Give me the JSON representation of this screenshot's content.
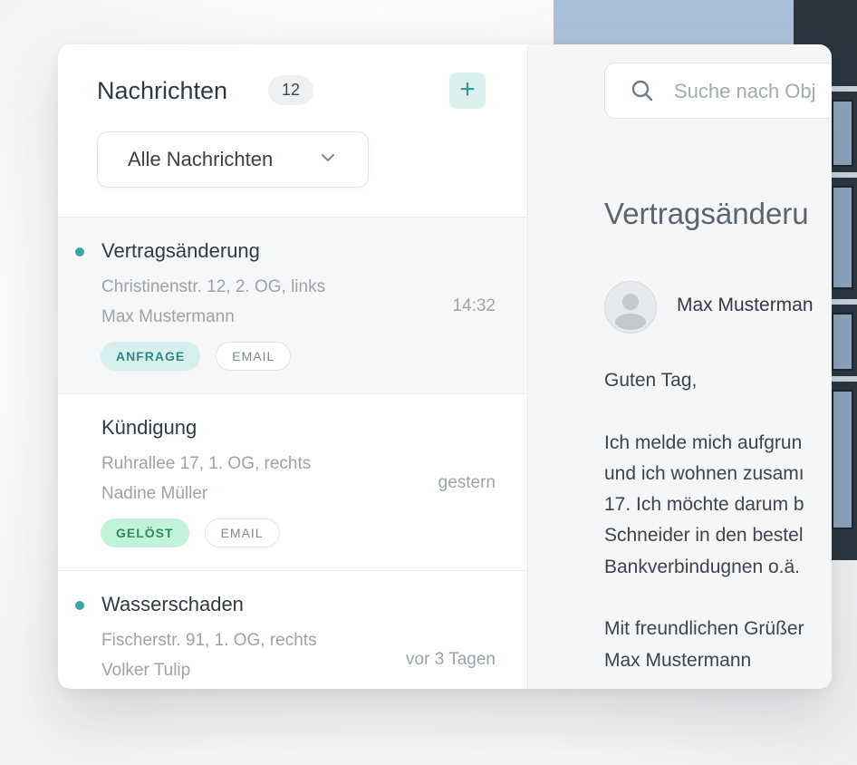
{
  "header": {
    "title": "Nachrichten",
    "count": "12",
    "add_label": "+"
  },
  "filter": {
    "selected": "Alle Nachrichten"
  },
  "messages": [
    {
      "title": "Vertragsänderung",
      "address": "Christinenstr. 12, 2. OG, links",
      "person": "Max Mustermann",
      "time": "14:32",
      "unread": true,
      "tags": [
        "ANFRAGE",
        "EMAIL"
      ]
    },
    {
      "title": "Kündigung",
      "address": "Ruhrallee 17, 1. OG, rechts",
      "person": "Nadine Müller",
      "time": "gestern",
      "unread": false,
      "tags": [
        "GELÖST",
        "EMAIL"
      ]
    },
    {
      "title": "Wasserschaden",
      "address": "Fischerstr. 91, 1. OG, rechts",
      "person": "Volker Tulip",
      "time": "vor 3 Tagen",
      "unread": true,
      "tags": []
    }
  ],
  "search": {
    "placeholder": "Suche nach Obj"
  },
  "detail": {
    "title": "Vertragsänderu",
    "sender": "Max Musterman",
    "greeting": "Guten Tag,",
    "body_lines": [
      "Ich melde mich aufgrun",
      "und ich wohnen zusamı",
      "17. Ich möchte darum b",
      "Schneider in den bestel",
      "Bankverbindugnen o.ä."
    ],
    "closing": "Mit freundlichen Grüßer",
    "signature": "Max Mustermann"
  },
  "colors": {
    "accent": "#3aa6a0",
    "anfrage_bg": "#d8eff0",
    "geloest_bg": "#c2f3d8"
  }
}
